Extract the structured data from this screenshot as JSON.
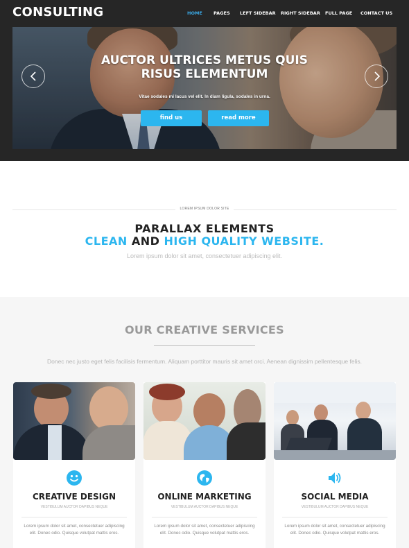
{
  "header": {
    "brand": "CONSULTING",
    "nav": [
      {
        "label": "HOME",
        "active": true
      },
      {
        "label": "PAGES",
        "active": false
      },
      {
        "label": "LEFT SIDEBAR",
        "active": false
      },
      {
        "label": "RIGHT SIDEBAR",
        "active": false
      },
      {
        "label": "FULL PAGE",
        "active": false
      },
      {
        "label": "CONTACT US",
        "active": false
      }
    ]
  },
  "hero": {
    "title_line1": "AUCTOR ULTRICES METUS QUIS",
    "title_line2": "RISUS ELEMENTUM",
    "subtitle": "Vitae sodales mi lacus vel elit. In diam ligula, sodales in urna.",
    "button_primary": "find us",
    "button_secondary": "read more",
    "prev_icon": "chevron-left-icon",
    "next_icon": "chevron-right-icon"
  },
  "parallax": {
    "caption": "LOREM IPSUM DOLOR SITE",
    "heading_line1": "PARALLAX ELEMENTS",
    "heading_line2_part1": "CLEAN",
    "heading_line2_part2": "AND",
    "heading_line2_part3": "HIGH QUALITY WEBSITE.",
    "text": "Lorem ipsum dolor sit amet, consectetuer adipiscing elit."
  },
  "services": {
    "title": "OUR CREATIVE SERVICES",
    "text": "Donec nec justo eget felis facilisis fermentum. Aliquam porttitor mauris sit amet orci. Aenean dignissim pellentesque felis.",
    "cards": [
      {
        "icon": "smiley-icon",
        "title": "CREATIVE DESIGN",
        "subtitle": "VESTIBULUM AUCTOR DAPIBUS NEQUE",
        "text": "Lorem ipsum dolor sit amet, consectetuer adipiscing elit. Donec odio. Quisque volutpat mattis eros."
      },
      {
        "icon": "globe-icon",
        "title": "ONLINE MARKETING",
        "subtitle": "VESTIBULUM AUCTOR DAPIBUS NEQUE",
        "text": "Lorem ipsum dolor sit amet, consectetuer adipiscing elit. Donec odio. Quisque volutpat mattis eros."
      },
      {
        "icon": "speaker-icon",
        "title": "SOCIAL MEDIA",
        "subtitle": "VESTIBULUM AUCTOR DAPIBUS NEQUE",
        "text": "Lorem ipsum dolor sit amet, consectetuer adipiscing elit. Donec odio. Quisque volutpat mattis eros."
      }
    ]
  },
  "colors": {
    "accent": "#2cb6ef",
    "nav_active": "#3aa9e6",
    "header_bg": "#262626",
    "section_bg": "#f6f6f6"
  }
}
